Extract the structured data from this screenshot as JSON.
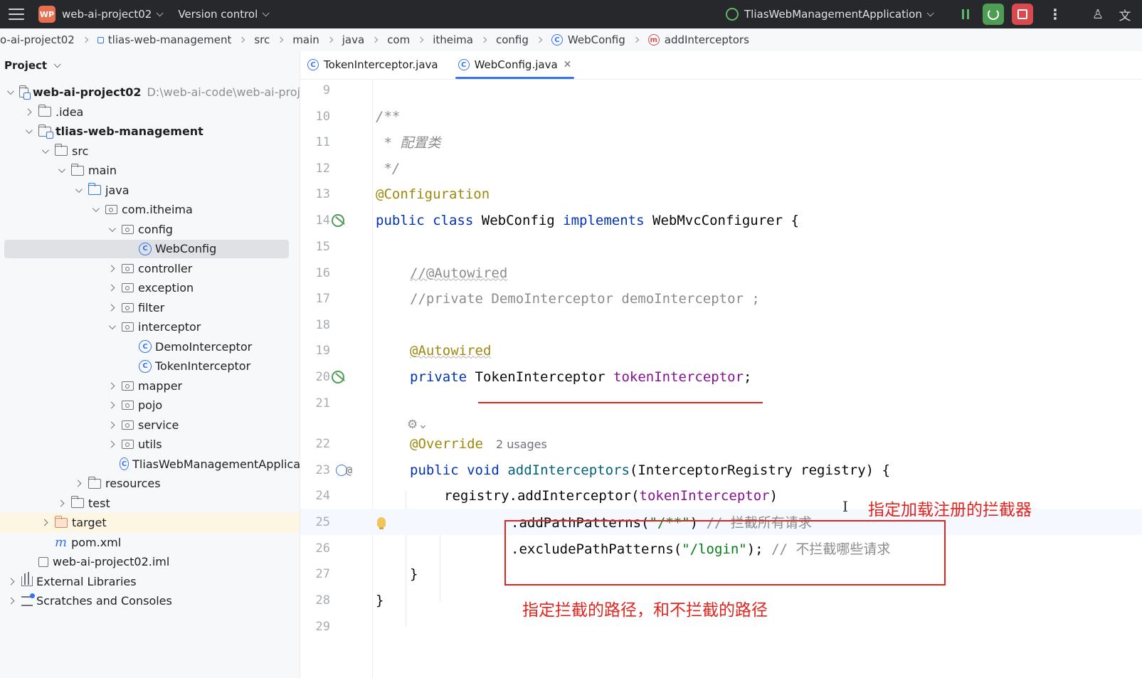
{
  "titlebar": {
    "project_badge": "WP",
    "project_name": "web-ai-project02",
    "vcs_label": "Version control",
    "run_config": "TliasWebManagementApplication"
  },
  "breadcrumb": [
    "o-ai-project02",
    "tlias-web-management",
    "src",
    "main",
    "java",
    "com",
    "itheima",
    "config",
    "WebConfig",
    "addInterceptors"
  ],
  "sidebar": {
    "title": "Project",
    "root_path": "D:\\web-ai-code\\web-ai-proj",
    "items": [
      "web-ai-project02",
      ".idea",
      "tlias-web-management",
      "src",
      "main",
      "java",
      "com.itheima",
      "config",
      "WebConfig",
      "controller",
      "exception",
      "filter",
      "interceptor",
      "DemoInterceptor",
      "TokenInterceptor",
      "mapper",
      "pojo",
      "service",
      "utils",
      "TliasWebManagementApplica",
      "resources",
      "test",
      "target",
      "pom.xml",
      "web-ai-project02.iml",
      "External Libraries",
      "Scratches and Consoles"
    ]
  },
  "tabs": [
    {
      "label": "TokenInterceptor.java"
    },
    {
      "label": "WebConfig.java"
    }
  ],
  "editor": {
    "line_numbers": [
      "9",
      "10",
      "11",
      "12",
      "13",
      "14",
      "15",
      "16",
      "17",
      "18",
      "19",
      "20",
      "21",
      "22",
      "23",
      "24",
      "25",
      "26",
      "27",
      "28",
      "29"
    ],
    "code": {
      "l10": "/**",
      "l11": " * 配置类",
      "l12": " */",
      "l13": "@Configuration",
      "l14_kw1": "public",
      "l14_kw2": "class",
      "l14_name": "WebConfig",
      "l14_kw3": "implements",
      "l14_iface": "WebMvcConfigurer",
      "l14_brace": "{",
      "l16": "//@Autowired",
      "l17": "//private DemoInterceptor demoInterceptor ;",
      "l19": "@Autowired",
      "l20_kw": "private",
      "l20_type": "TokenInterceptor",
      "l20_field": "tokenInterceptor",
      "l20_semi": ";",
      "l22_ann": "@Override",
      "l22_usages": "2 usages",
      "l23_kw1": "public",
      "l23_kw2": "void",
      "l23_fn": "addInterceptors",
      "l23_rest": "(InterceptorRegistry registry) {",
      "l24_pre": "registry.addInterceptor(",
      "l24_field": "tokenInterceptor",
      "l24_post": ")",
      "l25_pre": ".addPathPatterns(",
      "l25_str": "\"/**\"",
      "l25_post": ") ",
      "l25_cmt": "// 拦截所有请求",
      "l26_pre": ".excludePathPatterns(",
      "l26_str": "\"/login\"",
      "l26_post": "); ",
      "l26_cmt": "// 不拦截哪些请求",
      "l27": "}",
      "l28": "}"
    }
  },
  "annotations": {
    "note_register": "指定加载注册的拦截器",
    "note_paths": "指定拦截的路径，和不拦截的路径"
  },
  "colors": {
    "annotation_red": "#e0251f",
    "accent_blue": "#3574f0",
    "titlebar_bg": "#27282c"
  }
}
